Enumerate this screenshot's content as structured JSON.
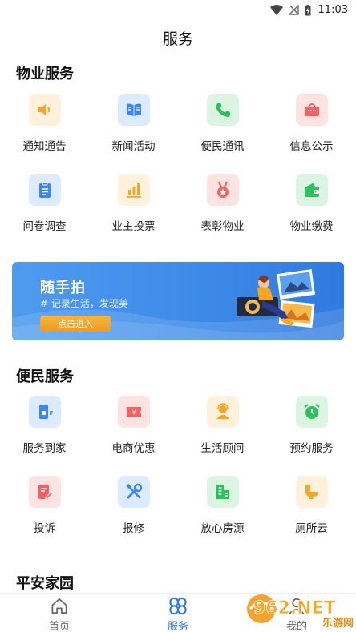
{
  "status_bar": {
    "time": "11:03",
    "icons": [
      "wifi-icon",
      "no-signal-icon",
      "battery-charging-icon"
    ]
  },
  "page_title": "服务",
  "sections": {
    "property": {
      "title": "物业服务",
      "items": [
        {
          "label": "通知通告",
          "icon": "speaker-icon",
          "bg": "#fff1dc",
          "color": "#f6a623"
        },
        {
          "label": "新闻活动",
          "icon": "book-icon",
          "bg": "#dcebff",
          "color": "#3b86f0"
        },
        {
          "label": "便民通讯",
          "icon": "phone-icon",
          "bg": "#dcf5e3",
          "color": "#2ec05d"
        },
        {
          "label": "信息公示",
          "icon": "bag-icon",
          "bg": "#ffe2e2",
          "color": "#f26262"
        },
        {
          "label": "问卷调查",
          "icon": "clipboard-icon",
          "bg": "#dcebff",
          "color": "#3b86f0"
        },
        {
          "label": "业主投票",
          "icon": "bar-chart-icon",
          "bg": "#fff1dc",
          "color": "#f6a623"
        },
        {
          "label": "表彰物业",
          "icon": "medal-icon",
          "bg": "#ffe2e2",
          "color": "#f26262"
        },
        {
          "label": "物业缴费",
          "icon": "wallet-icon",
          "bg": "#dcf5e3",
          "color": "#2ec05d"
        }
      ]
    },
    "convenience": {
      "title": "便民服务",
      "items": [
        {
          "label": "服务到家",
          "icon": "door-icon",
          "bg": "#dcebff",
          "color": "#3b86f0"
        },
        {
          "label": "电商优惠",
          "icon": "coupon-icon",
          "bg": "#ffe2e2",
          "color": "#f26262"
        },
        {
          "label": "生活顾问",
          "icon": "advisor-icon",
          "bg": "#fff1dc",
          "color": "#f6a623"
        },
        {
          "label": "预约服务",
          "icon": "alarm-clock-icon",
          "bg": "#dcf5e3",
          "color": "#2ec05d"
        },
        {
          "label": "投诉",
          "icon": "edit-doc-icon",
          "bg": "#ffe2e2",
          "color": "#f26262"
        },
        {
          "label": "报修",
          "icon": "tools-icon",
          "bg": "#dcebff",
          "color": "#3b86f0"
        },
        {
          "label": "放心房源",
          "icon": "building-icon",
          "bg": "#dcf5e3",
          "color": "#2ec05d"
        },
        {
          "label": "厕所云",
          "icon": "toilet-icon",
          "bg": "#fff1dc",
          "color": "#f6a623"
        }
      ]
    },
    "safety": {
      "title": "平安家园"
    }
  },
  "banner": {
    "title": "随手拍",
    "subtitle": "# 记录生活，发现美",
    "button": "点击进入"
  },
  "tabbar": {
    "tabs": [
      {
        "label": "首页",
        "icon": "home-icon",
        "active": false
      },
      {
        "label": "服务",
        "icon": "services-icon",
        "active": true
      },
      {
        "label": "我的",
        "icon": "profile-icon",
        "active": false
      }
    ],
    "active_color": "#2f7ae0",
    "inactive_color": "#666666"
  },
  "watermark": {
    "text": "962.NET",
    "subtext": "乐游网"
  }
}
